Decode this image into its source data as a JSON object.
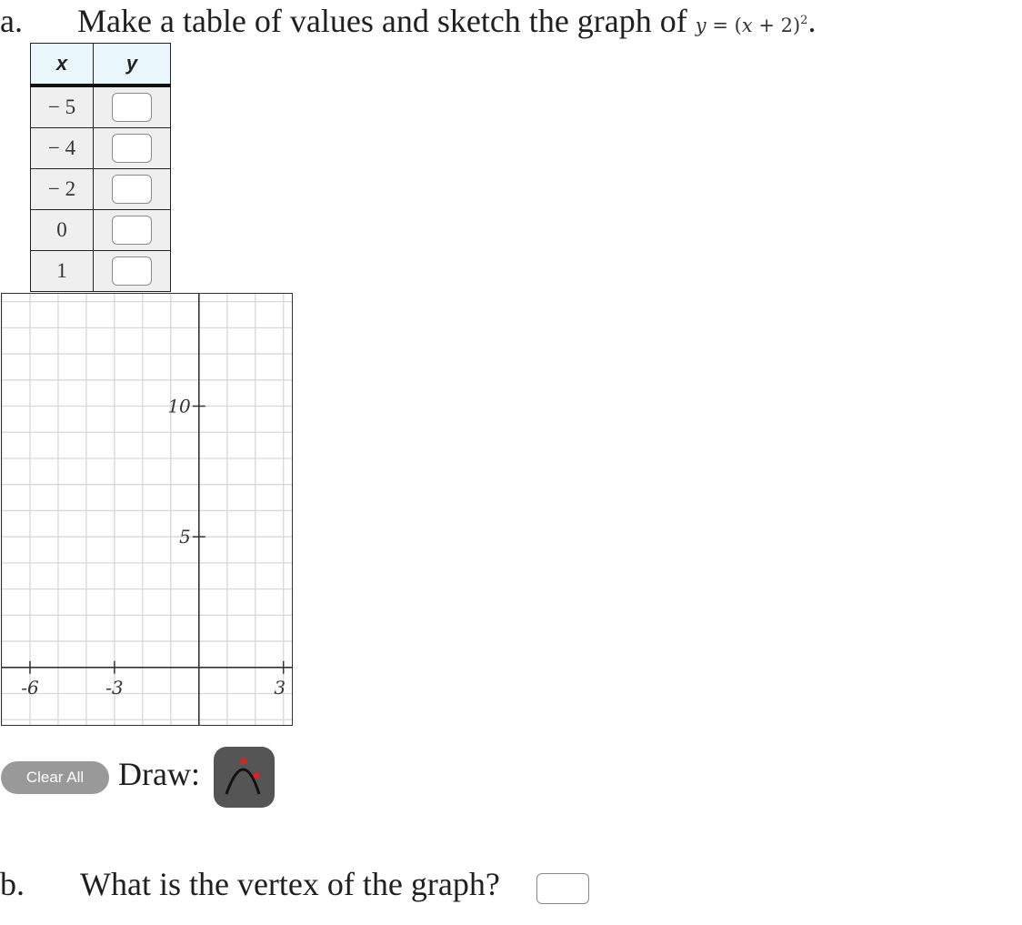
{
  "part_a": {
    "label": "a.",
    "prompt": "Make a table of values and sketch the graph of",
    "equation": {
      "lhs": "y",
      "eq": "=",
      "open": "(",
      "var": "x",
      "plus": "+ 2)",
      "exponent": "2",
      "end": "."
    }
  },
  "table": {
    "headers": {
      "x": "x",
      "y": "y"
    },
    "rows": [
      {
        "x": "− 5",
        "y": ""
      },
      {
        "x": "− 4",
        "y": ""
      },
      {
        "x": "− 2",
        "y": ""
      },
      {
        "x": "0",
        "y": ""
      },
      {
        "x": "1",
        "y": ""
      }
    ]
  },
  "graph": {
    "x_range": [
      -7,
      3.3
    ],
    "y_range": [
      -2.2,
      14.3
    ],
    "x_tick_labels": [
      "-6",
      "-3",
      "3"
    ],
    "y_tick_labels": [
      "5",
      "10"
    ]
  },
  "controls": {
    "clear_all": "Clear All",
    "draw_label": "Draw:",
    "draw_tool_icon": "parabola-tool-icon"
  },
  "part_b": {
    "label": "b.",
    "prompt": "What is the vertex of the graph?",
    "answer": ""
  },
  "colors": {
    "header_bg": "#e9f6fb",
    "cell_bg": "#efefef",
    "grid": "#d8d8d8",
    "button": "#999999",
    "tool_bg": "#555555",
    "tool_point": "#e02020"
  }
}
